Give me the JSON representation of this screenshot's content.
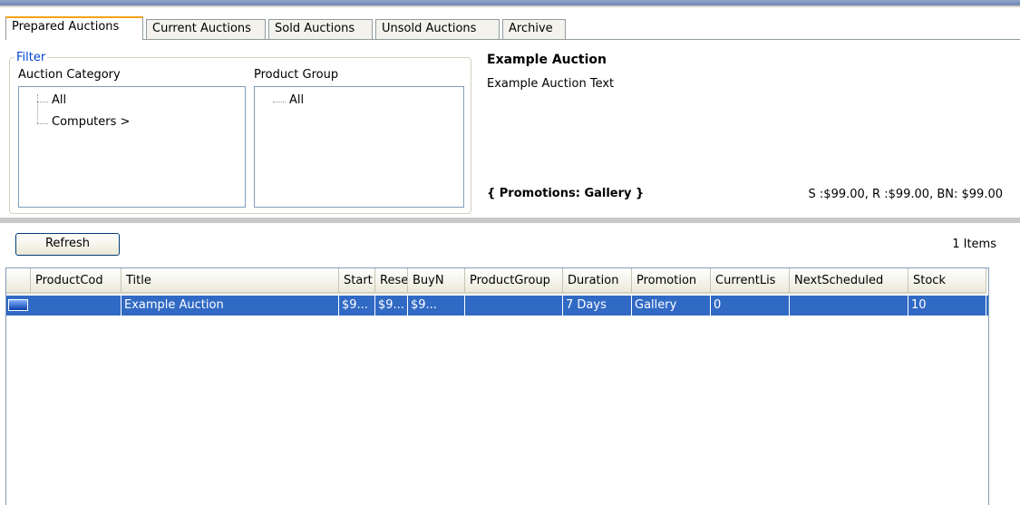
{
  "tabs": [
    "Prepared Auctions",
    "Current Auctions",
    "Sold Auctions",
    "Unsold Auctions",
    "Archive"
  ],
  "filter": {
    "legend": "Filter",
    "category_label": "Auction Category",
    "category_items": [
      "All",
      "Computers >"
    ],
    "group_label": "Product Group",
    "group_items": [
      "All"
    ]
  },
  "detail": {
    "title": "Example Auction",
    "text": "Example Auction Text",
    "promotions": "{ Promotions: Gallery }",
    "prices": "S :$99.00, R :$99.00, BN: $99.00"
  },
  "toolbar": {
    "refresh_label": "Refresh",
    "items_count": "1 Items"
  },
  "list": {
    "columns": [
      "",
      "ProductCod",
      "Title",
      "Start",
      "Rese",
      "BuyN",
      "ProductGroup",
      "Duration",
      "Promotion",
      "CurrentLis",
      "NextScheduled",
      "Stock"
    ],
    "rows": [
      [
        "",
        "",
        "Example Auction",
        "$9...",
        "$9...",
        "$9...",
        "",
        "7 Days",
        "Gallery",
        "0",
        "",
        "10"
      ]
    ]
  },
  "colors": {
    "selection": "#316ac5",
    "tab_accent": "#f3a21b",
    "legend": "#0046d5"
  }
}
